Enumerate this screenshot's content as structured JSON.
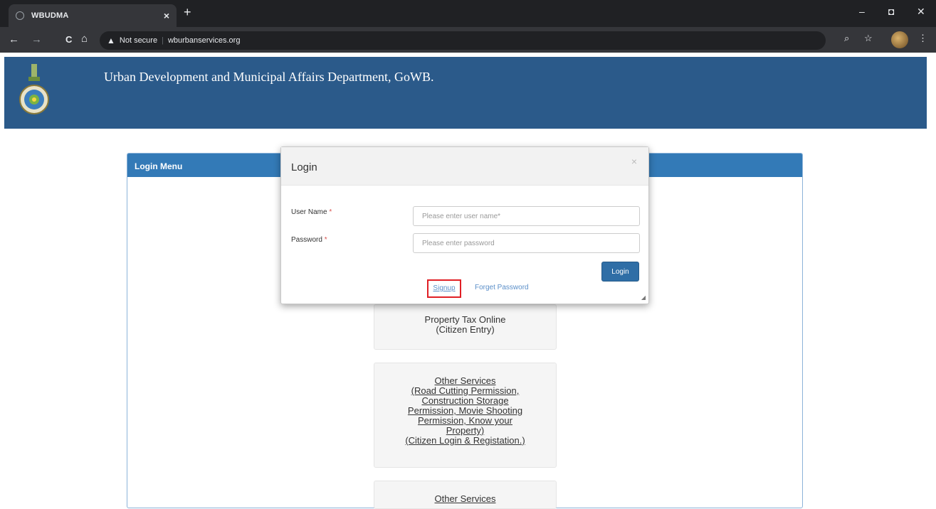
{
  "browser": {
    "tab_title": "WBUDMA",
    "tab_close": "×",
    "new_tab": "+",
    "minimize": "–",
    "maximize": "◘",
    "close": "✕",
    "back": "←",
    "forward": "→",
    "reload": "C",
    "home": "⌂",
    "security_warning": "▲",
    "security_label": "Not secure",
    "url": "wburbanservices.org",
    "zoom_icon": "⌕",
    "star_icon": "☆",
    "menu_icon": "⋮"
  },
  "header": {
    "title": "Urban Development and Municipal Affairs Department, GoWB."
  },
  "panel": {
    "title": "Login Menu"
  },
  "services": [
    {
      "lines": [
        "Property Tax Online",
        "(Citizen Entry)"
      ]
    },
    {
      "lines": [
        "Other Services",
        "(Road Cutting Permission,",
        "Construction Storage",
        "Permission, Movie Shooting",
        "Permission, Know your",
        "Property)",
        "(Citizen Login & Registation.)"
      ]
    },
    {
      "lines": [
        "Other Services"
      ]
    }
  ],
  "modal": {
    "title": "Login",
    "close": "×",
    "username_label": "User Name",
    "password_label": "Password",
    "required_mark": "*",
    "username_placeholder": "Please enter user name*",
    "password_placeholder": "Please enter password",
    "login_button": "Login",
    "signup_link": "Signup",
    "forget_link": "Forget Password"
  },
  "colors": {
    "banner": "#2b5a8a",
    "panel_header": "#337ab7",
    "login_button": "#2f6ea6",
    "highlight": "#e01f25"
  }
}
